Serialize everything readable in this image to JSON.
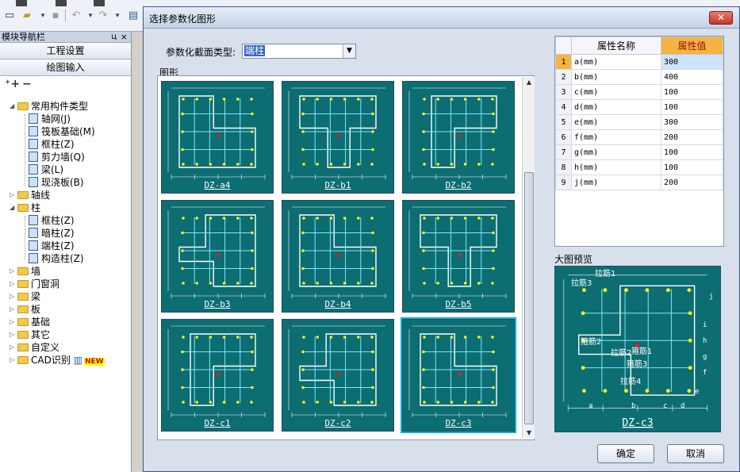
{
  "toolbar": {
    "icons": [
      "new-file-icon",
      "open-folder-icon",
      "save-icon",
      "undo-icon",
      "redo-icon",
      "layer-icon"
    ]
  },
  "nav": {
    "title": "模块导航栏",
    "pin": "ц",
    "close": "×",
    "btn_settings": "工程设置",
    "btn_drawing": "绘图输入",
    "tree": [
      {
        "label": "常用构件类型",
        "kind": "folder",
        "level": 0,
        "expand": "◢"
      },
      {
        "label": "轴网(J)",
        "kind": "icon",
        "level": 1
      },
      {
        "label": "筏板基础(M)",
        "kind": "icon",
        "level": 1
      },
      {
        "label": "框柱(Z)",
        "kind": "icon",
        "level": 1
      },
      {
        "label": "剪力墙(Q)",
        "kind": "icon",
        "level": 1
      },
      {
        "label": "梁(L)",
        "kind": "icon",
        "level": 1
      },
      {
        "label": "现浇板(B)",
        "kind": "icon",
        "level": 1
      },
      {
        "label": "轴线",
        "kind": "folder",
        "level": 0,
        "expand": "▷"
      },
      {
        "label": "柱",
        "kind": "folder",
        "level": 0,
        "expand": "◢"
      },
      {
        "label": "框柱(Z)",
        "kind": "icon",
        "level": 1
      },
      {
        "label": "暗柱(Z)",
        "kind": "icon",
        "level": 1
      },
      {
        "label": "端柱(Z)",
        "kind": "icon",
        "level": 1
      },
      {
        "label": "构造柱(Z)",
        "kind": "icon",
        "level": 1
      },
      {
        "label": "墙",
        "kind": "folder",
        "level": 0,
        "expand": "▷"
      },
      {
        "label": "门窗洞",
        "kind": "folder",
        "level": 0,
        "expand": "▷"
      },
      {
        "label": "梁",
        "kind": "folder",
        "level": 0,
        "expand": "▷"
      },
      {
        "label": "板",
        "kind": "folder",
        "level": 0,
        "expand": "▷"
      },
      {
        "label": "基础",
        "kind": "folder",
        "level": 0,
        "expand": "▷"
      },
      {
        "label": "其它",
        "kind": "folder",
        "level": 0,
        "expand": "▷"
      },
      {
        "label": "自定义",
        "kind": "folder",
        "level": 0,
        "expand": "▷"
      },
      {
        "label": "CAD识别",
        "kind": "folder",
        "level": 0,
        "expand": "▷",
        "badge": "NEW"
      }
    ]
  },
  "dialog": {
    "title": "选择参数化图形",
    "close": "✕",
    "type_label": "参数化截面类型:",
    "type_value": "端柱",
    "gallery_label": "图形",
    "preview_label": "大图预览",
    "ok": "确定",
    "cancel": "取消",
    "shapes": [
      {
        "name": "DZ-a4"
      },
      {
        "name": "DZ-b1"
      },
      {
        "name": "DZ-b2"
      },
      {
        "name": "DZ-b3"
      },
      {
        "name": "DZ-b4"
      },
      {
        "name": "DZ-b5"
      },
      {
        "name": "DZ-c1"
      },
      {
        "name": "DZ-c2"
      },
      {
        "name": "DZ-c3",
        "selected": true
      }
    ],
    "preview_name": "DZ-c3",
    "preview_labels": [
      "拉筋1",
      "拉筋3",
      "箍筋2",
      "拉筋2",
      "箍筋1",
      "箍筋3",
      "拉筋4"
    ],
    "preview_dims": [
      "a",
      "b",
      "c",
      "d",
      "e",
      "f",
      "g",
      "h",
      "i",
      "j"
    ]
  },
  "props": {
    "col_name": "属性名称",
    "col_value": "属性值",
    "rows": [
      {
        "idx": "1",
        "name": "a(mm)",
        "value": "300"
      },
      {
        "idx": "2",
        "name": "b(mm)",
        "value": "400"
      },
      {
        "idx": "3",
        "name": "c(mm)",
        "value": "100"
      },
      {
        "idx": "4",
        "name": "d(mm)",
        "value": "100"
      },
      {
        "idx": "5",
        "name": "e(mm)",
        "value": "300"
      },
      {
        "idx": "6",
        "name": "f(mm)",
        "value": "200"
      },
      {
        "idx": "7",
        "name": "g(mm)",
        "value": "100"
      },
      {
        "idx": "8",
        "name": "h(mm)",
        "value": "100"
      },
      {
        "idx": "9",
        "name": "j(mm)",
        "value": "200"
      }
    ]
  }
}
